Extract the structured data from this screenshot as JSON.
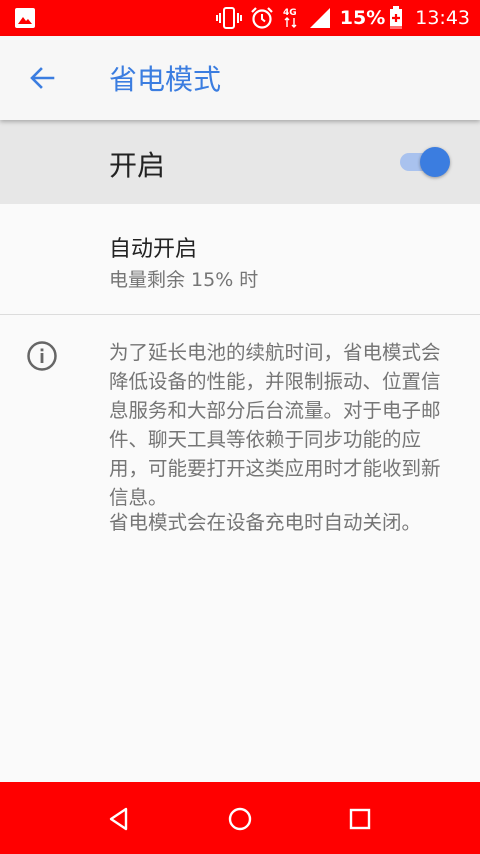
{
  "status_bar": {
    "battery_percent": "15%",
    "time": "13:43",
    "icons": [
      "gallery-icon",
      "vibrate-icon",
      "alarm-icon",
      "4g-data-icon",
      "signal-icon",
      "battery-charging-icon"
    ],
    "network_type": "4G"
  },
  "app_bar": {
    "title": "省电模式",
    "back_icon": "arrow-back-icon",
    "accent_color": "#3b7de0"
  },
  "main_switch": {
    "label": "开启",
    "state": "on"
  },
  "auto_enable": {
    "title": "自动开启",
    "summary": "电量剩余 15% 时"
  },
  "info": {
    "icon": "info-icon",
    "paragraph": "为了延长电池的续航时间，省电模式会降低设备的性能，并限制振动、位置信息服务和大部分后台流量。对于电子邮件、聊天工具等依赖于同步功能的应用，可能要打开这类应用时才能收到新信息。",
    "note": "省电模式会在设备充电时自动关闭。"
  },
  "nav_bar": {
    "icons": [
      "nav-back-icon",
      "nav-home-icon",
      "nav-recents-icon"
    ],
    "color": "#ff0000"
  }
}
